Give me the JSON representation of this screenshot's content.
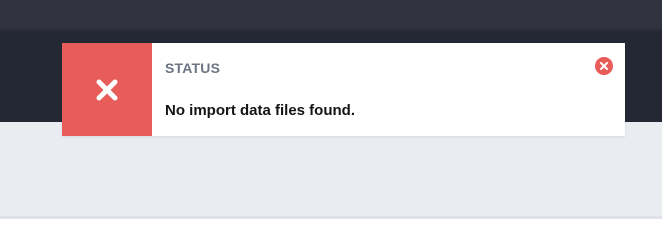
{
  "notification": {
    "title": "STATUS",
    "message": "No import data files found.",
    "type_icon": "x-icon",
    "close_icon": "close-circle-icon"
  },
  "colors": {
    "header_background": "#242734",
    "page_background": "#e9edf1",
    "error_accent": "#e85c5a",
    "title_text": "#6d7483",
    "message_text": "#141414"
  }
}
